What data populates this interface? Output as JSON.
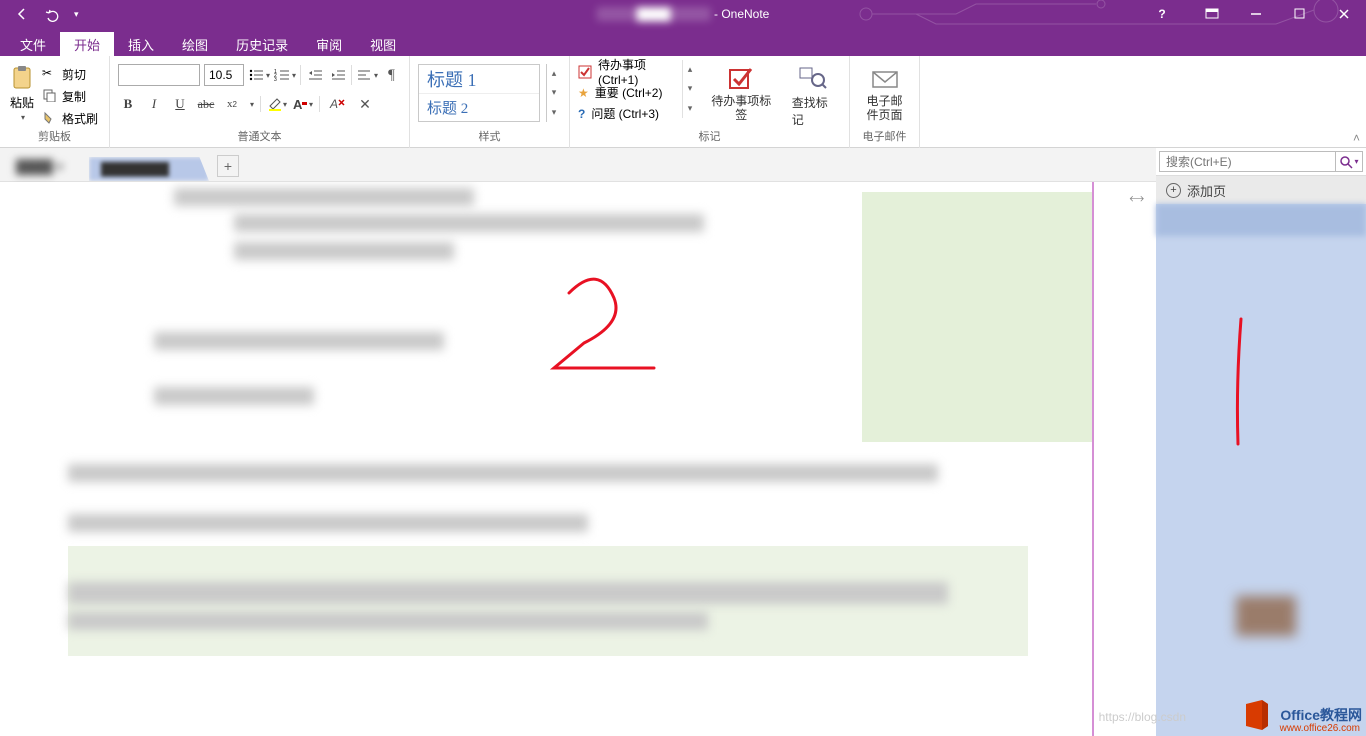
{
  "titlebar": {
    "app": "- OneNote",
    "help": "?"
  },
  "tabs": {
    "file": "文件",
    "home": "开始",
    "insert": "插入",
    "draw": "绘图",
    "history": "历史记录",
    "review": "审阅",
    "view": "视图"
  },
  "clipboard": {
    "paste": "粘贴",
    "cut": "剪切",
    "copy": "复制",
    "painter": "格式刷",
    "group": "剪贴板"
  },
  "font": {
    "size": "10.5",
    "group": "普通文本"
  },
  "styles": {
    "h1": "标题 1",
    "h2": "标题 2",
    "group": "样式"
  },
  "tags": {
    "todo": "待办事项 (Ctrl+1)",
    "important": "重要 (Ctrl+2)",
    "question": "问题 (Ctrl+3)",
    "todo_btn": "待办事项标签",
    "find": "查找标记",
    "group": "标记"
  },
  "email": {
    "btn": "电子邮件页面",
    "group": "电子邮件"
  },
  "search": {
    "placeholder": "搜索(Ctrl+E)"
  },
  "pagepane": {
    "add": "添加页"
  },
  "watermark": {
    "brand": "Office教程网",
    "url": "www.office26.com"
  },
  "bgurl": "https://blog.csdn"
}
